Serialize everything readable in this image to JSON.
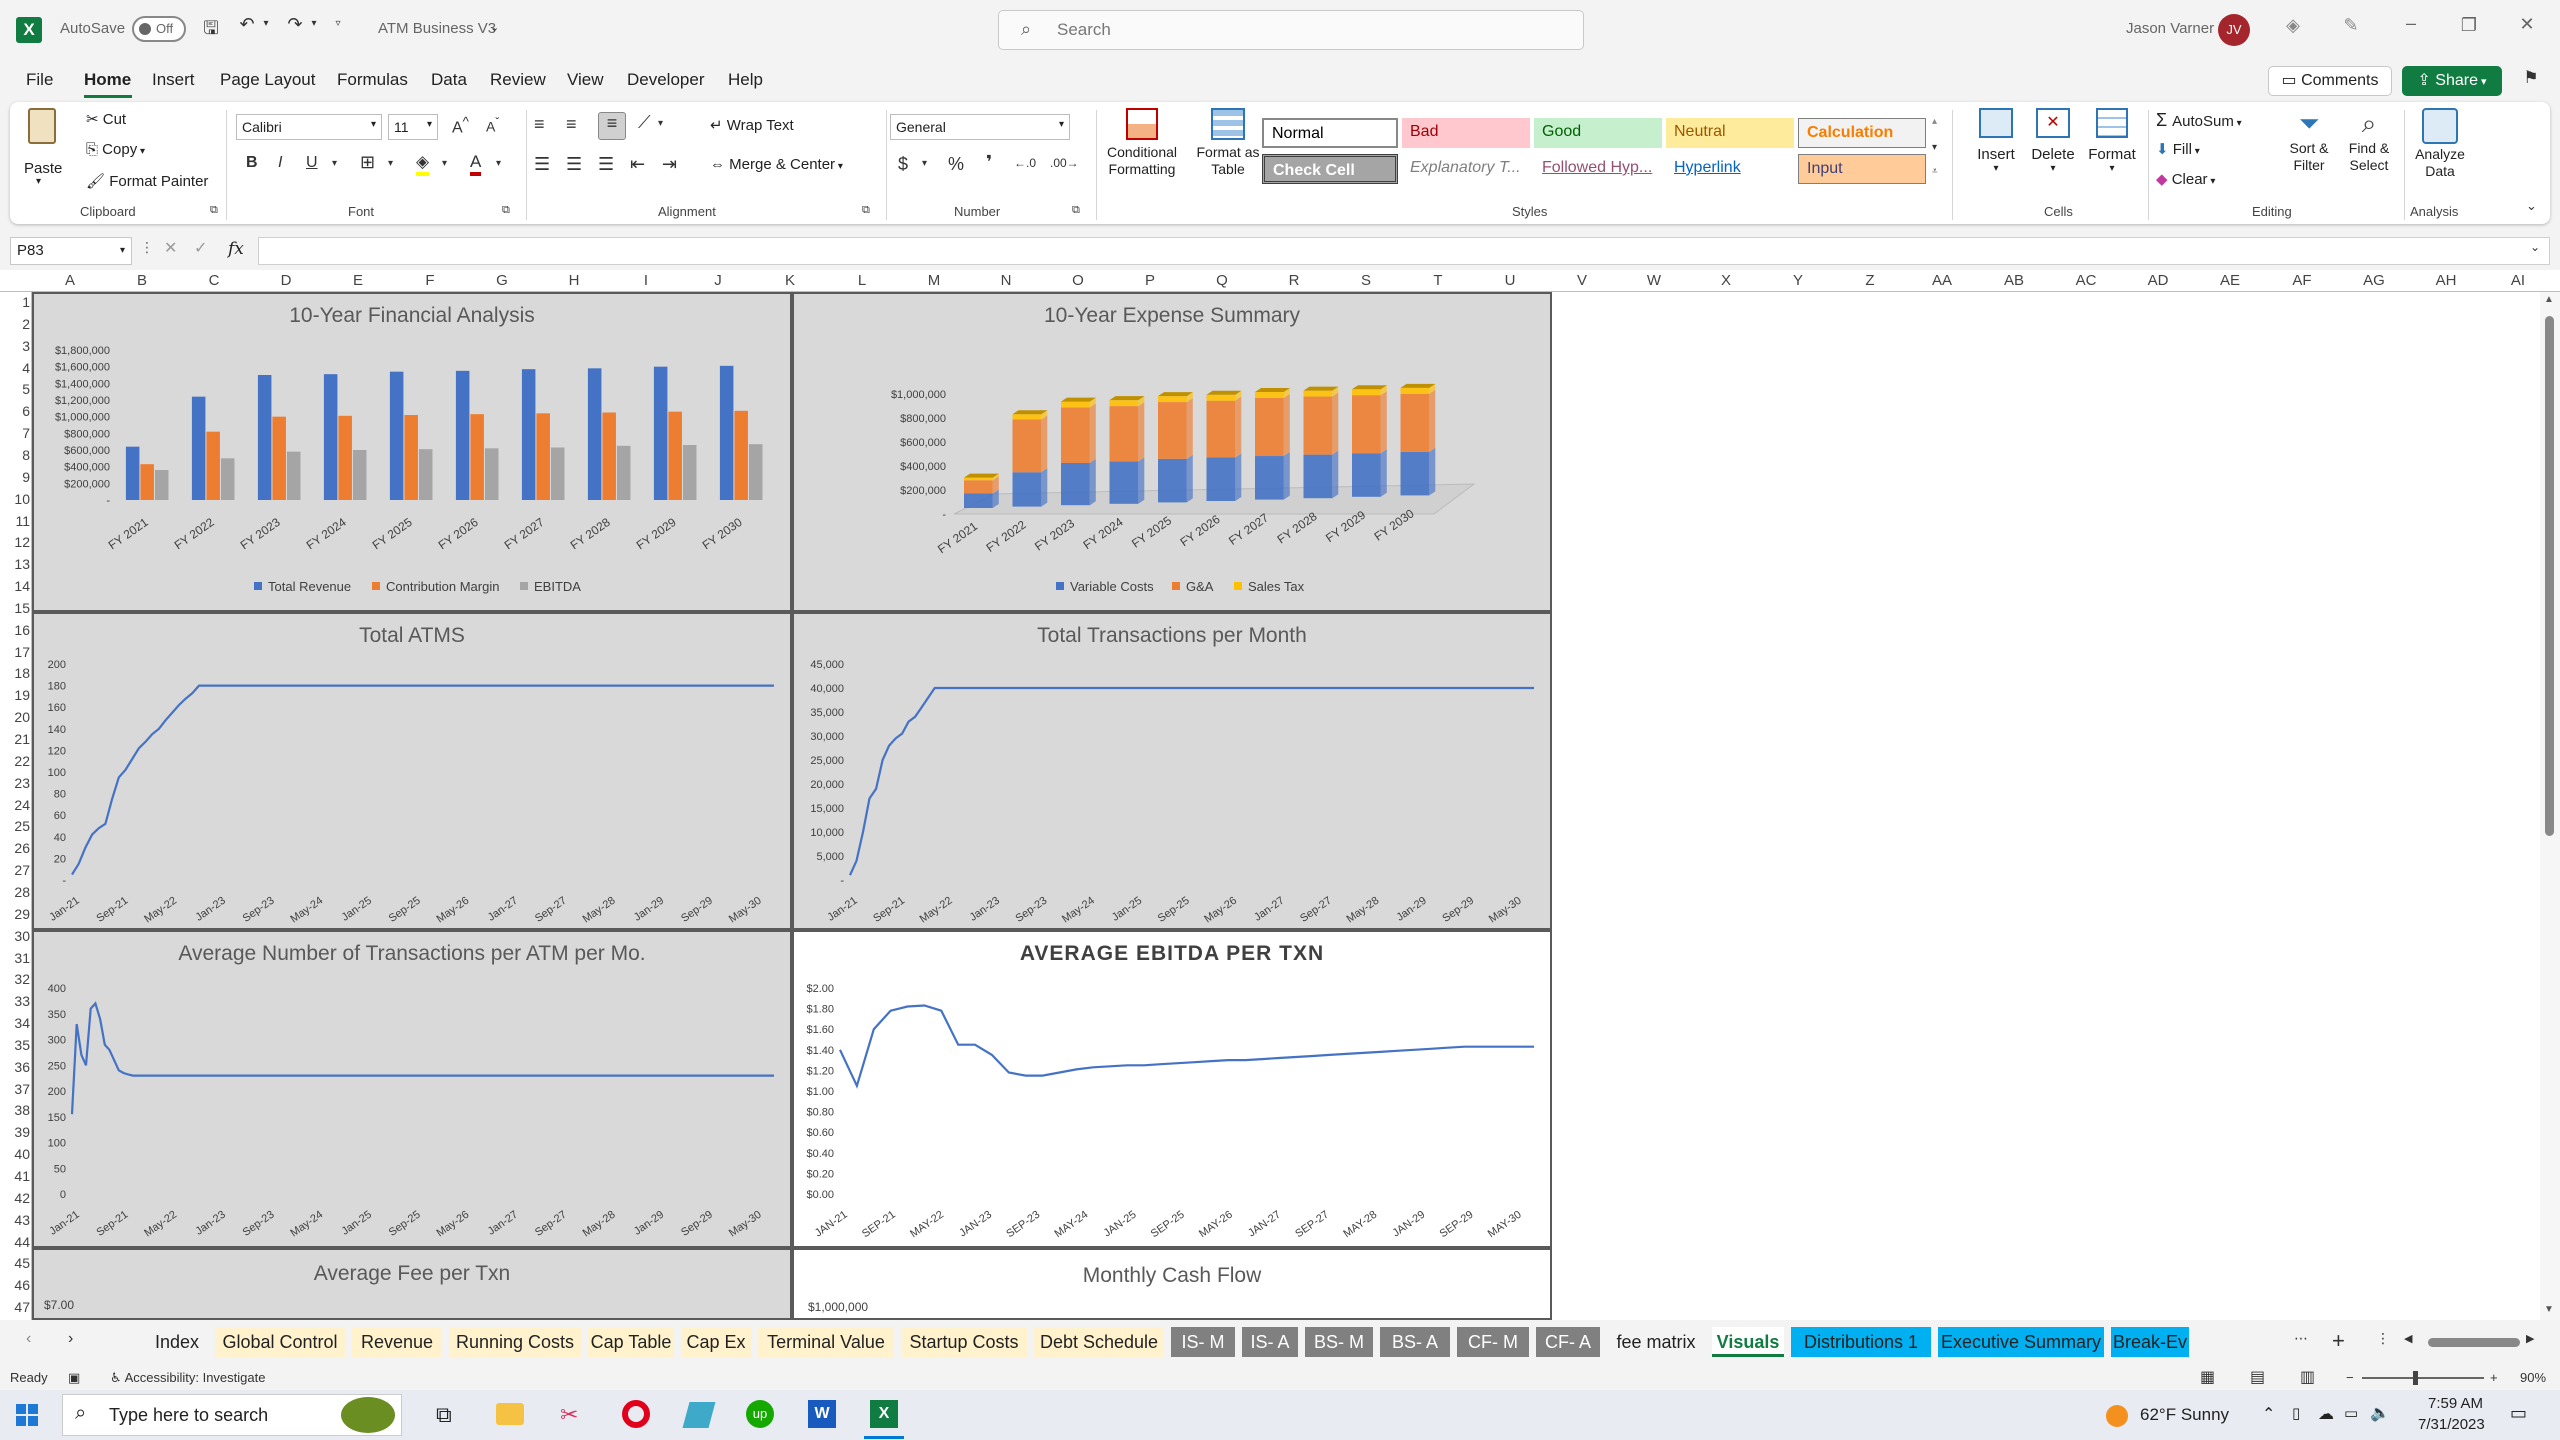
{
  "titlebar": {
    "autosave_label": "AutoSave",
    "autosave_state": "Off",
    "doc_title": "ATM Business V3",
    "search_placeholder": "Search",
    "user_name": "Jason Varner",
    "user_initials": "JV"
  },
  "menu": {
    "items": [
      "File",
      "Home",
      "Insert",
      "Page Layout",
      "Formulas",
      "Data",
      "Review",
      "View",
      "Developer",
      "Help"
    ],
    "active": "Home",
    "comments": "Comments",
    "share": "Share"
  },
  "ribbon": {
    "clipboard": {
      "paste": "Paste",
      "cut": "Cut",
      "copy": "Copy",
      "format_painter": "Format Painter",
      "label": "Clipboard"
    },
    "font": {
      "name": "Calibri",
      "size": "11",
      "label": "Font"
    },
    "alignment": {
      "wrap": "Wrap Text",
      "merge": "Merge & Center",
      "label": "Alignment"
    },
    "number": {
      "format": "General",
      "label": "Number"
    },
    "styles": {
      "conditional": "Conditional Formatting",
      "format_table": "Format as Table",
      "cells": [
        {
          "text": "Normal",
          "bg": "#ffffff",
          "fg": "#000000"
        },
        {
          "text": "Bad",
          "bg": "#ffc7ce",
          "fg": "#9c0006"
        },
        {
          "text": "Good",
          "bg": "#c6efce",
          "fg": "#006100"
        },
        {
          "text": "Neutral",
          "bg": "#ffeb9c",
          "fg": "#9c5700"
        },
        {
          "text": "Calculation",
          "bg": "#f2f2f2",
          "fg": "#fa7d00"
        },
        {
          "text": "Check Cell",
          "bg": "#a5a5a5",
          "fg": "#ffffff"
        },
        {
          "text": "Explanatory T...",
          "bg": "#ffffff",
          "fg": "#7f7f7f"
        },
        {
          "text": "Followed Hyp...",
          "bg": "#ffffff",
          "fg": "#954f72"
        },
        {
          "text": "Hyperlink",
          "bg": "#ffffff",
          "fg": "#0563c1"
        },
        {
          "text": "Input",
          "bg": "#ffcc99",
          "fg": "#3f3f76"
        }
      ],
      "label": "Styles"
    },
    "cells": {
      "insert": "Insert",
      "delete": "Delete",
      "format": "Format",
      "label": "Cells"
    },
    "editing": {
      "autosum": "AutoSum",
      "fill": "Fill",
      "clear": "Clear",
      "sort": "Sort & Filter",
      "find": "Find & Select",
      "label": "Editing"
    },
    "analysis": {
      "analyze": "Analyze Data",
      "label": "Analysis"
    }
  },
  "formula_bar": {
    "name_box": "P83",
    "fx": "fx"
  },
  "columns": [
    "A",
    "B",
    "C",
    "D",
    "E",
    "F",
    "G",
    "H",
    "I",
    "J",
    "K",
    "L",
    "M",
    "N",
    "O",
    "P",
    "Q",
    "R",
    "S",
    "T",
    "U",
    "V",
    "W",
    "X",
    "Y",
    "Z",
    "AA",
    "AB",
    "AC",
    "AD",
    "AE",
    "AF",
    "AG",
    "AH",
    "AI"
  ],
  "rows": [
    "1",
    "2",
    "3",
    "4",
    "5",
    "6",
    "7",
    "8",
    "9",
    "10",
    "11",
    "12",
    "13",
    "14",
    "15",
    "16",
    "17",
    "18",
    "19",
    "20",
    "21",
    "22",
    "23",
    "24",
    "25",
    "26",
    "27",
    "28",
    "29",
    "30",
    "31",
    "32",
    "33",
    "34",
    "35",
    "36",
    "37",
    "38",
    "39",
    "40",
    "41",
    "42",
    "43",
    "44",
    "45",
    "46",
    "47"
  ],
  "chart_data": [
    {
      "type": "bar",
      "title": "10-Year Financial Analysis",
      "categories": [
        "FY 2021",
        "FY 2022",
        "FY 2023",
        "FY 2024",
        "FY 2025",
        "FY 2026",
        "FY 2027",
        "FY 2028",
        "FY 2029",
        "FY 2030"
      ],
      "series": [
        {
          "name": "Total Revenue",
          "color": "#4472c4",
          "values": [
            640000,
            1240000,
            1500000,
            1510000,
            1540000,
            1550000,
            1570000,
            1580000,
            1600000,
            1610000
          ]
        },
        {
          "name": "Contribution Margin",
          "color": "#ed7d31",
          "values": [
            430000,
            820000,
            1000000,
            1010000,
            1020000,
            1030000,
            1040000,
            1050000,
            1060000,
            1070000
          ]
        },
        {
          "name": "EBITDA",
          "color": "#a5a5a5",
          "values": [
            360000,
            500000,
            580000,
            600000,
            610000,
            620000,
            630000,
            650000,
            660000,
            670000
          ]
        }
      ],
      "yticks": [
        "-",
        "$200,000",
        "$400,000",
        "$600,000",
        "$800,000",
        "$1,000,000",
        "$1,200,000",
        "$1,400,000",
        "$1,600,000",
        "$1,800,000"
      ],
      "ylim": [
        0,
        1800000
      ]
    },
    {
      "type": "bar",
      "title": "10-Year Expense Summary",
      "stacked": true,
      "categories": [
        "FY 2021",
        "FY 2022",
        "FY 2023",
        "FY 2024",
        "FY 2025",
        "FY 2026",
        "FY 2027",
        "FY 2028",
        "FY 2029",
        "FY 2030"
      ],
      "series": [
        {
          "name": "Variable Costs",
          "color": "#4472c4",
          "values": [
            110000,
            260000,
            320000,
            320000,
            330000,
            330000,
            330000,
            330000,
            330000,
            330000
          ]
        },
        {
          "name": "G&A",
          "color": "#ed7d31",
          "values": [
            100000,
            400000,
            420000,
            420000,
            430000,
            430000,
            440000,
            440000,
            440000,
            440000
          ]
        },
        {
          "name": "Sales Tax",
          "color": "#ffc000",
          "values": [
            20000,
            40000,
            45000,
            45000,
            45000,
            45000,
            45000,
            45000,
            45000,
            45000
          ]
        }
      ],
      "yticks": [
        "-",
        "$200,000",
        "$400,000",
        "$600,000",
        "$800,000",
        "$1,000,000"
      ],
      "ylim": [
        0,
        1000000
      ]
    },
    {
      "type": "line",
      "title": "Total ATMS",
      "xticks": [
        "Jan-21",
        "Sep-21",
        "May-22",
        "Jan-23",
        "Sep-23",
        "May-24",
        "Jan-25",
        "Sep-25",
        "May-26",
        "Jan-27",
        "Sep-27",
        "May-28",
        "Jan-29",
        "Sep-29",
        "May-30"
      ],
      "yticks": [
        "-",
        "20",
        "40",
        "60",
        "80",
        "100",
        "120",
        "140",
        "160",
        "180",
        "200"
      ],
      "ylim": [
        0,
        200
      ],
      "values": [
        5,
        15,
        30,
        42,
        48,
        52,
        75,
        95,
        102,
        112,
        122,
        128,
        135,
        140,
        148,
        155,
        162,
        168,
        173,
        180,
        180,
        180,
        180,
        180,
        180,
        180,
        180,
        180,
        180,
        180,
        180,
        180,
        180,
        180,
        180,
        180,
        180,
        180,
        180,
        180,
        180,
        180,
        180
      ]
    },
    {
      "type": "line",
      "title": "Total Transactions per Month",
      "xticks": [
        "Jan-21",
        "Sep-21",
        "May-22",
        "Jan-23",
        "Sep-23",
        "May-24",
        "Jan-25",
        "Sep-25",
        "May-26",
        "Jan-27",
        "Sep-27",
        "May-28",
        "Jan-29",
        "Sep-29",
        "May-30"
      ],
      "yticks": [
        "-",
        "5,000",
        "10,000",
        "15,000",
        "20,000",
        "25,000",
        "30,000",
        "35,000",
        "40,000",
        "45,000"
      ],
      "ylim": [
        0,
        45000
      ],
      "values": [
        1000,
        4000,
        10000,
        17000,
        19000,
        25000,
        28000,
        29500,
        30500,
        33000,
        34000,
        36000,
        38000,
        40000,
        40000,
        40000,
        40000,
        40000,
        40000,
        40000,
        40000,
        40000,
        40000,
        40000,
        40000,
        40000,
        40000,
        40000,
        40000,
        40000,
        40000,
        40000,
        40000,
        40000,
        40000,
        40000,
        40000,
        40000,
        40000,
        40000,
        40000,
        40000,
        40000
      ]
    },
    {
      "type": "line",
      "title": "Average Number of Transactions per ATM per Mo.",
      "xticks": [
        "Jan-21",
        "Sep-21",
        "May-22",
        "Jan-23",
        "Sep-23",
        "May-24",
        "Jan-25",
        "Sep-25",
        "May-26",
        "Jan-27",
        "Sep-27",
        "May-28",
        "Jan-29",
        "Sep-29",
        "May-30"
      ],
      "yticks": [
        "0",
        "50",
        "100",
        "150",
        "200",
        "250",
        "300",
        "350",
        "400"
      ],
      "ylim": [
        0,
        400
      ],
      "values": [
        155,
        330,
        270,
        250,
        360,
        370,
        340,
        290,
        280,
        260,
        240,
        235,
        232,
        230,
        230,
        230,
        230,
        230,
        230,
        230,
        230,
        230,
        230,
        230,
        230,
        230,
        230,
        230,
        230,
        230,
        230,
        230,
        230,
        230,
        230,
        230,
        230,
        230,
        230,
        230,
        230,
        230,
        230
      ]
    },
    {
      "type": "line",
      "title": "AVERAGE EBITDA PER TXN",
      "xticks": [
        "JAN-21",
        "SEP-21",
        "MAY-22",
        "JAN-23",
        "SEP-23",
        "MAY-24",
        "JAN-25",
        "SEP-25",
        "MAY-26",
        "JAN-27",
        "SEP-27",
        "MAY-28",
        "JAN-29",
        "SEP-29",
        "MAY-30"
      ],
      "yticks": [
        "$0.00",
        "$0.20",
        "$0.40",
        "$0.60",
        "$0.80",
        "$1.00",
        "$1.20",
        "$1.40",
        "$1.60",
        "$1.80",
        "$2.00"
      ],
      "ylim": [
        0,
        2
      ],
      "values": [
        1.4,
        1.05,
        1.6,
        1.78,
        1.82,
        1.83,
        1.78,
        1.45,
        1.45,
        1.35,
        1.18,
        1.15,
        1.15,
        1.18,
        1.21,
        1.23,
        1.24,
        1.25,
        1.25,
        1.26,
        1.27,
        1.28,
        1.29,
        1.3,
        1.3,
        1.31,
        1.32,
        1.33,
        1.34,
        1.35,
        1.36,
        1.37,
        1.38,
        1.39,
        1.4,
        1.41,
        1.42,
        1.43
      ]
    },
    {
      "type": "line",
      "title": "Average Fee per Txn",
      "yticks": [
        "$7.00"
      ]
    },
    {
      "type": "line",
      "title": "Monthly Cash Flow",
      "yticks": [
        "$1,000,000"
      ]
    }
  ],
  "tabs": [
    {
      "label": "Index",
      "bg": "#f3f3f3",
      "fg": "#222"
    },
    {
      "label": "Global Control",
      "bg": "#fff2cc",
      "fg": "#222"
    },
    {
      "label": "Revenue",
      "bg": "#fff2cc",
      "fg": "#222"
    },
    {
      "label": "Running Costs",
      "bg": "#fff2cc",
      "fg": "#222"
    },
    {
      "label": "Cap Table",
      "bg": "#fff2cc",
      "fg": "#222"
    },
    {
      "label": "Cap Ex",
      "bg": "#fff2cc",
      "fg": "#222"
    },
    {
      "label": "Terminal Value",
      "bg": "#fff2cc",
      "fg": "#222"
    },
    {
      "label": "Startup Costs",
      "bg": "#fff2cc",
      "fg": "#222"
    },
    {
      "label": "Debt Schedule",
      "bg": "#fff2cc",
      "fg": "#222"
    },
    {
      "label": "IS- M",
      "bg": "#808080",
      "fg": "#fff"
    },
    {
      "label": "IS- A",
      "bg": "#808080",
      "fg": "#fff"
    },
    {
      "label": "BS- M",
      "bg": "#808080",
      "fg": "#fff"
    },
    {
      "label": "BS- A",
      "bg": "#808080",
      "fg": "#fff"
    },
    {
      "label": "CF- M",
      "bg": "#808080",
      "fg": "#fff"
    },
    {
      "label": "CF- A",
      "bg": "#808080",
      "fg": "#fff"
    },
    {
      "label": "fee matrix",
      "bg": "#f3f3f3",
      "fg": "#222"
    },
    {
      "label": "Visuals",
      "bg": "#ffffff",
      "fg": "#222"
    },
    {
      "label": "Distributions 1",
      "bg": "#00b0f0",
      "fg": "#222"
    },
    {
      "label": "Executive Summary",
      "bg": "#00b0f0",
      "fg": "#222"
    },
    {
      "label": "Break-Ev",
      "bg": "#00b0f0",
      "fg": "#222"
    }
  ],
  "status": {
    "ready": "Ready",
    "accessibility": "Accessibility: Investigate",
    "zoom": "90%"
  },
  "taskbar": {
    "search_placeholder": "Type here to search",
    "weather": "62°F  Sunny",
    "time": "7:59 AM",
    "date": "7/31/2023"
  }
}
